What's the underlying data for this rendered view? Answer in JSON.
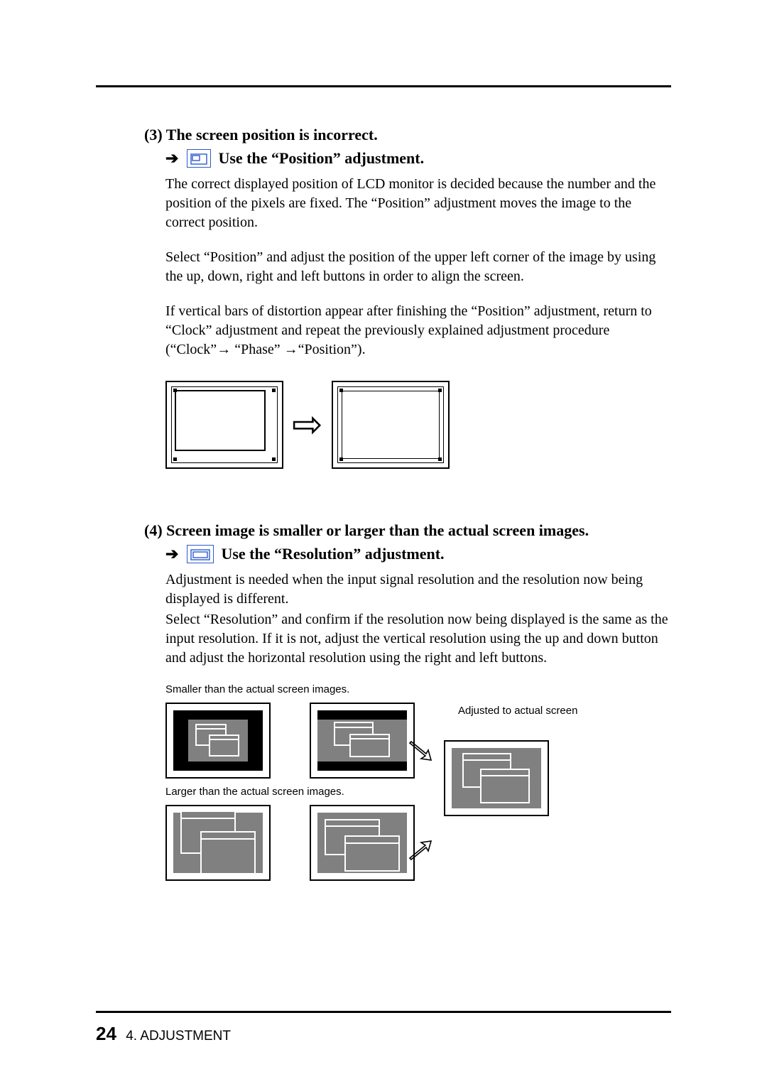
{
  "section3": {
    "number": "(3)",
    "title": "The screen position is incorrect.",
    "subhead": "Use the “Position” adjustment.",
    "para1": "The correct displayed position of LCD monitor is decided because the number and the position of the pixels are fixed.  The “Position” adjustment moves the image to the correct position.",
    "para2": "Select “Position” and adjust the position of the upper left corner of the image by using the up, down, right and left buttons in order to align the screen.",
    "para3": "If vertical bars of distortion appear after finishing the “Position” adjustment, return to “Clock” adjustment and repeat the previously explained adjustment procedure (“Clock”→ “Phase” →“Position”)."
  },
  "section4": {
    "number": "(4)",
    "title": "Screen image is smaller or larger than the actual screen images.",
    "subhead": "Use the “Resolution” adjustment.",
    "para1": "Adjustment is needed when the input signal resolution and the resolution now being displayed is different.",
    "para2": "Select “Resolution” and confirm if the resolution now being displayed is the same as the input resolution.  If it is not, adjust the vertical resolution using the up and down button and adjust the horizontal resolution using the right and left buttons.",
    "caption_smaller": "Smaller than the actual screen images.",
    "caption_larger": "Larger than the actual screen images.",
    "caption_adjusted": "Adjusted to actual screen"
  },
  "footer": {
    "page": "24",
    "section": "4. ADJUSTMENT"
  }
}
